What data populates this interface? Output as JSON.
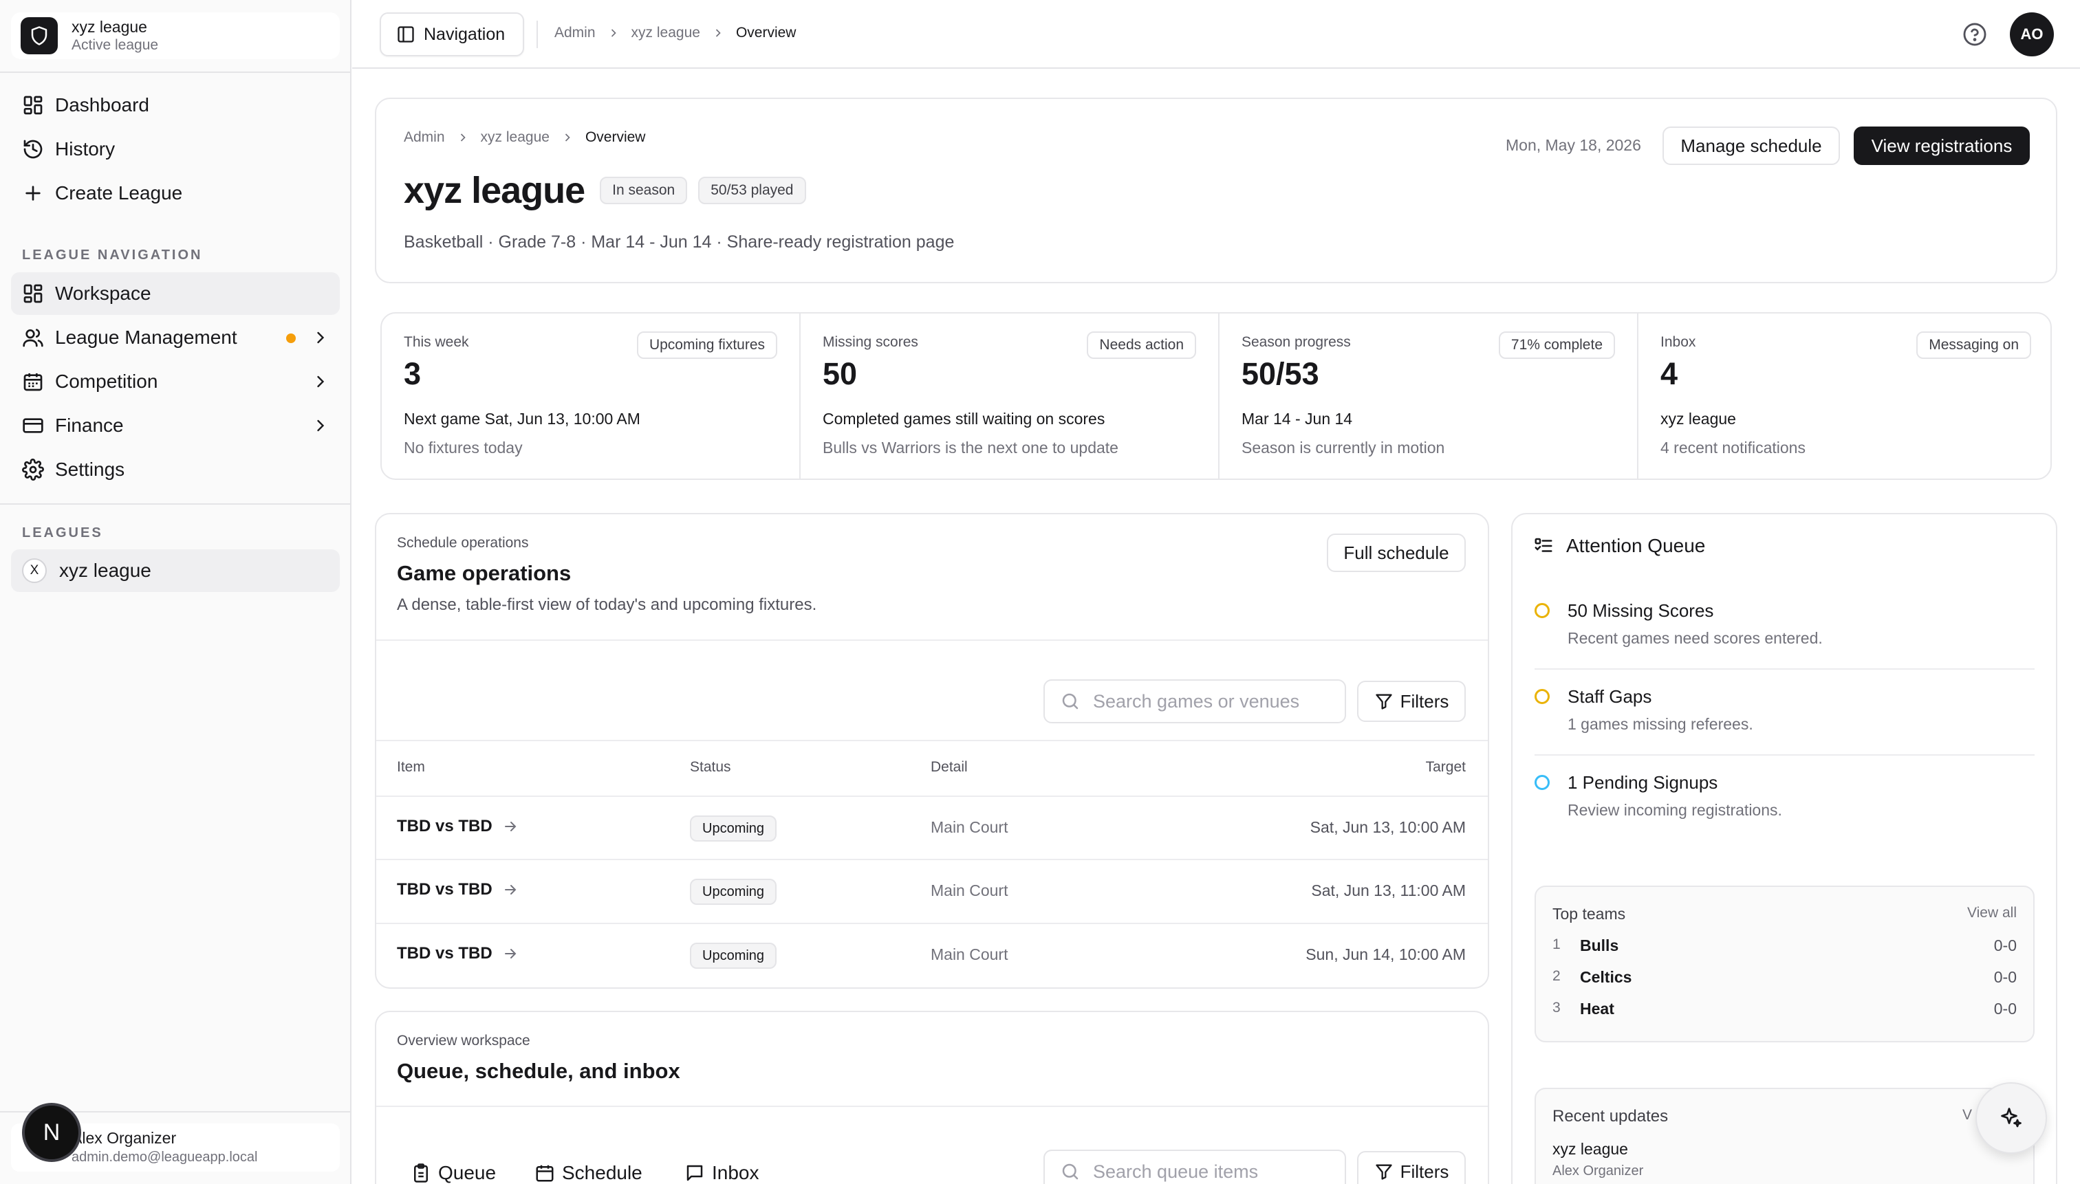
{
  "sidebar": {
    "league_name": "xyz league",
    "league_status": "Active league",
    "primary": [
      {
        "label": "Dashboard"
      },
      {
        "label": "History"
      },
      {
        "label": "Create League"
      }
    ],
    "section_nav": "LEAGUE NAVIGATION",
    "league_nav": [
      {
        "label": "Workspace"
      },
      {
        "label": "League Management"
      },
      {
        "label": "Competition"
      },
      {
        "label": "Finance"
      },
      {
        "label": "Settings"
      }
    ],
    "section_leagues": "LEAGUES",
    "leagues": [
      {
        "initial": "X",
        "label": "xyz league"
      }
    ],
    "user": {
      "name": "Alex Organizer",
      "email": "admin.demo@leagueapp.local",
      "badge": "N"
    }
  },
  "topbar": {
    "nav_button": "Navigation",
    "breadcrumb": [
      "Admin",
      "xyz league",
      "Overview"
    ],
    "avatar": "AO"
  },
  "header": {
    "breadcrumb": [
      "Admin",
      "xyz league",
      "Overview"
    ],
    "title": "xyz league",
    "badge_status": "In season",
    "badge_played": "50/53 played",
    "subtitle": "Basketball · Grade 7-8 · Mar 14 - Jun 14 · Share-ready registration page",
    "date": "Mon, May 18, 2026",
    "manage_schedule": "Manage schedule",
    "view_registrations": "View registrations"
  },
  "stats": [
    {
      "label": "This week",
      "value": "3",
      "pill": "Upcoming fixtures",
      "main": "Next game Sat, Jun 13, 10:00 AM",
      "sub": "No fixtures today"
    },
    {
      "label": "Missing scores",
      "value": "50",
      "pill": "Needs action",
      "main": "Completed games still waiting on scores",
      "sub": "Bulls vs Warriors is the next one to update"
    },
    {
      "label": "Season progress",
      "value": "50/53",
      "pill": "71% complete",
      "main": "Mar 14 - Jun 14",
      "sub": "Season is currently in motion"
    },
    {
      "label": "Inbox",
      "value": "4",
      "pill": "Messaging on",
      "main": "xyz league",
      "sub": "4 recent notifications"
    }
  ],
  "game_ops": {
    "eyebrow": "Schedule operations",
    "title": "Game operations",
    "description": "A dense, table-first view of today's and upcoming fixtures.",
    "full_schedule": "Full schedule",
    "search_placeholder": "Search games or venues",
    "filters": "Filters",
    "columns": [
      "Item",
      "Status",
      "Detail",
      "Target"
    ],
    "rows": [
      {
        "item": "TBD vs TBD",
        "status": "Upcoming",
        "detail": "Main Court",
        "target": "Sat, Jun 13, 10:00 AM"
      },
      {
        "item": "TBD vs TBD",
        "status": "Upcoming",
        "detail": "Main Court",
        "target": "Sat, Jun 13, 11:00 AM"
      },
      {
        "item": "TBD vs TBD",
        "status": "Upcoming",
        "detail": "Main Court",
        "target": "Sun, Jun 14, 10:00 AM"
      }
    ]
  },
  "workspace": {
    "eyebrow": "Overview workspace",
    "title": "Queue, schedule, and inbox",
    "tabs": [
      "Queue",
      "Schedule",
      "Inbox"
    ],
    "search_placeholder": "Search queue items",
    "filters": "Filters"
  },
  "attention": {
    "title": "Attention Queue",
    "items": [
      {
        "title": "50 Missing Scores",
        "sub": "Recent games need scores entered.",
        "color": "#eab308"
      },
      {
        "title": "Staff Gaps",
        "sub": "1 games missing referees.",
        "color": "#eab308"
      },
      {
        "title": "1 Pending Signups",
        "sub": "Review incoming registrations.",
        "color": "#38bdf8"
      }
    ]
  },
  "top_teams": {
    "title": "Top teams",
    "view_all": "View all",
    "teams": [
      {
        "rank": "1",
        "name": "Bulls",
        "record": "0-0"
      },
      {
        "rank": "2",
        "name": "Celtics",
        "record": "0-0"
      },
      {
        "rank": "3",
        "name": "Heat",
        "record": "0-0"
      }
    ]
  },
  "recent_updates": {
    "title": "Recent updates",
    "view_all_partial": "V",
    "league": "xyz league",
    "author": "Alex Organizer"
  }
}
